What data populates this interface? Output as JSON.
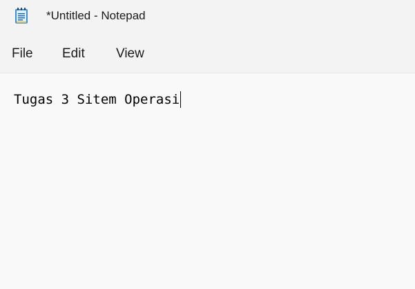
{
  "window": {
    "title": "*Untitled - Notepad",
    "app_icon": "notepad-icon"
  },
  "menu": {
    "file": "File",
    "edit": "Edit",
    "view": "View"
  },
  "editor": {
    "content": "Tugas 3 Sitem Operasi"
  },
  "colors": {
    "chrome_background": "#f3f3f3",
    "editor_background": "#f9f9f9",
    "icon_blue": "#3a8fd9"
  }
}
